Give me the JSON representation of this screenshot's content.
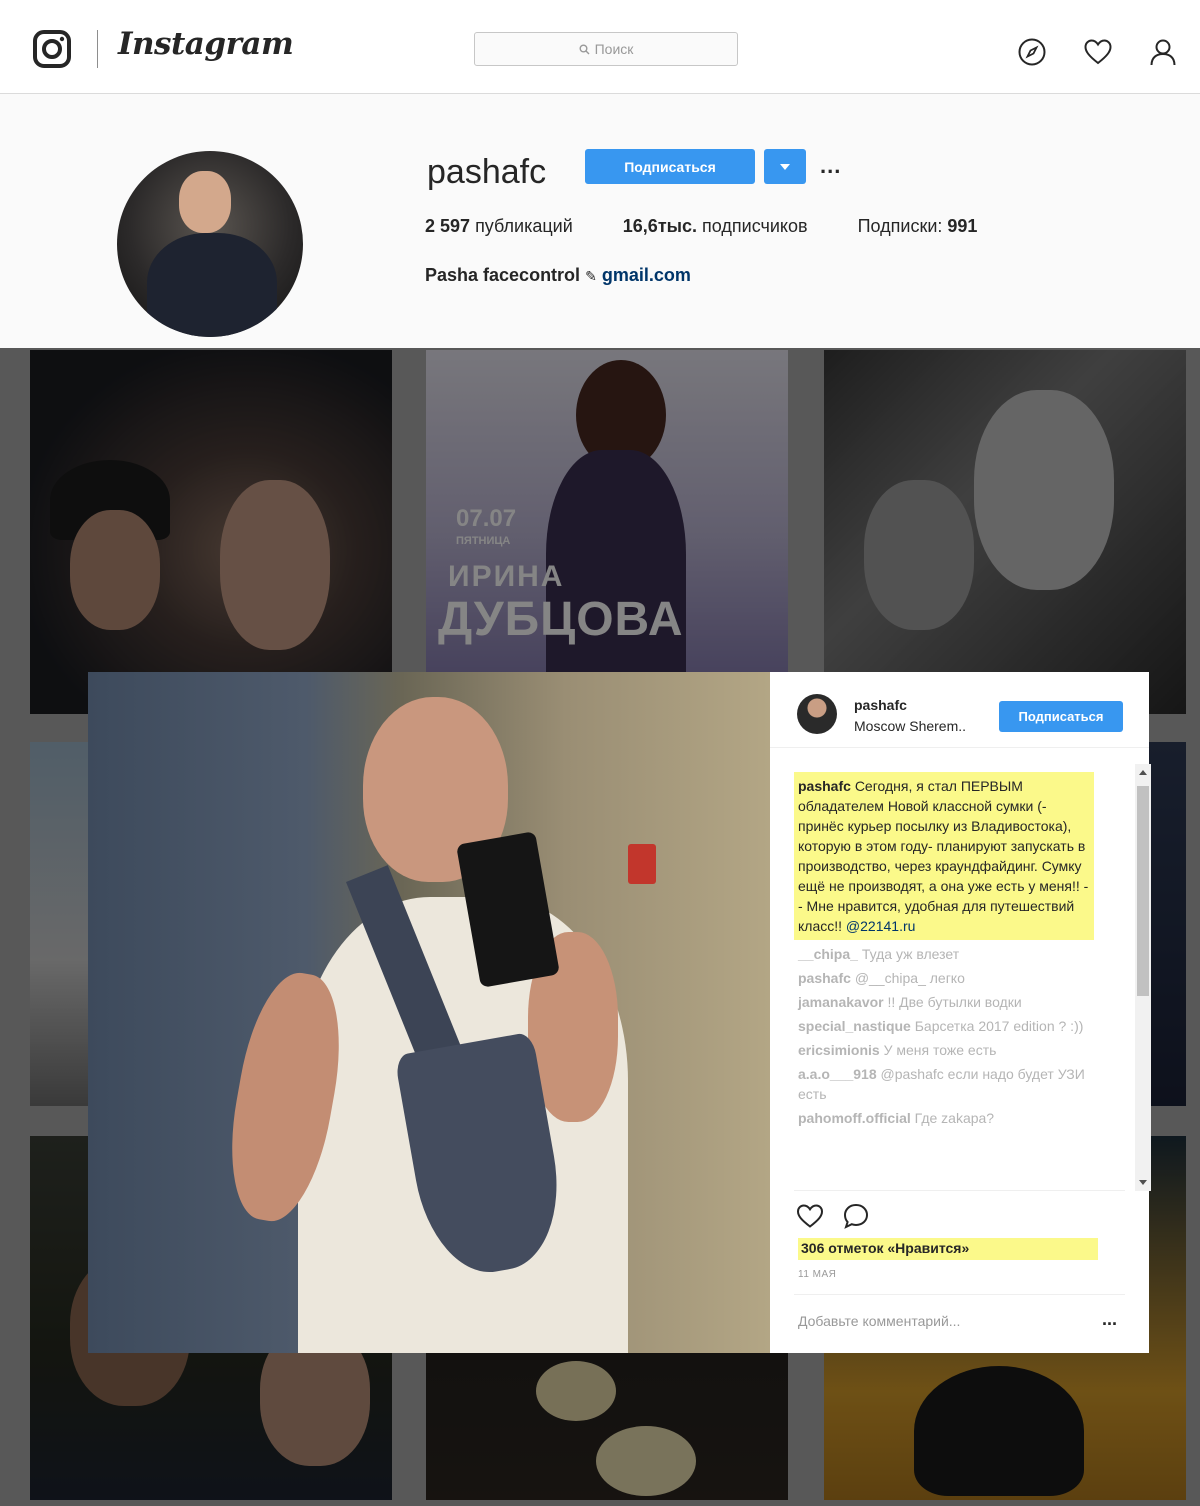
{
  "nav": {
    "wordmark": "Instagram",
    "search_placeholder": "Поиск"
  },
  "profile": {
    "username": "pashafc",
    "follow_label": "Подписаться",
    "more": "...",
    "posts_count": "2 597",
    "posts_label": "публикаций",
    "followers_count": "16,6тыс.",
    "followers_label": "подписчиков",
    "following_label": "Подписки:",
    "following_count": "991",
    "bio_name": "Pasha facecontrol",
    "bio_link": "gmail.com"
  },
  "grid": {
    "poster_date": "07.07",
    "poster_day": "ПЯТНИЦА",
    "poster_name_1": "ИРИНА",
    "poster_name_2": "ДУБЦОВА"
  },
  "modal": {
    "username": "pashafc",
    "location": "Moscow Sherem..",
    "follow_label": "Подписаться",
    "caption_user": "pashafc",
    "caption_text": "Сегодня,  я стал ПЕРВЫМ обладателем Новой классной сумки (-принёс курьер  посылку  из Владивостока), которую в этом году-  планируют  запускать в производство, через краундфайдинг. Сумку  ещё не производят, а она уже есть у меня!! -- Мне нравится, удобная для путешествий класс!!",
    "caption_mention": "@22141.ru",
    "comments": [
      {
        "user": "__chipa_",
        "text": "Туда уж влезет"
      },
      {
        "user": "pashafc",
        "text": "@__chipa_ легко"
      },
      {
        "user": "jamanakavor",
        "text": "!! Две бутылки водки"
      },
      {
        "user": "special_nastique",
        "text": "Барсетка 2017 edition ? :))"
      },
      {
        "user": "ericsimionis",
        "text": "У меня тоже есть"
      },
      {
        "user": "a.a.o___918",
        "text": "@pashafc если надо будет УЗИ есть"
      },
      {
        "user": "pahomoff.official",
        "text": "Где zakapa?"
      }
    ],
    "likes": "306 отметок «Нравится»",
    "date": "11 МАЯ",
    "add_comment_placeholder": "Добавьте комментарий...",
    "add_more": "..."
  },
  "colors": {
    "accent": "#3897f0",
    "highlight": "#fbf98a",
    "link": "#003569"
  },
  "icons": [
    "instagram-glyph-icon",
    "search-icon",
    "explore-compass-icon",
    "heart-icon",
    "profile-icon",
    "chevron-down-icon",
    "comment-bubble-icon"
  ]
}
